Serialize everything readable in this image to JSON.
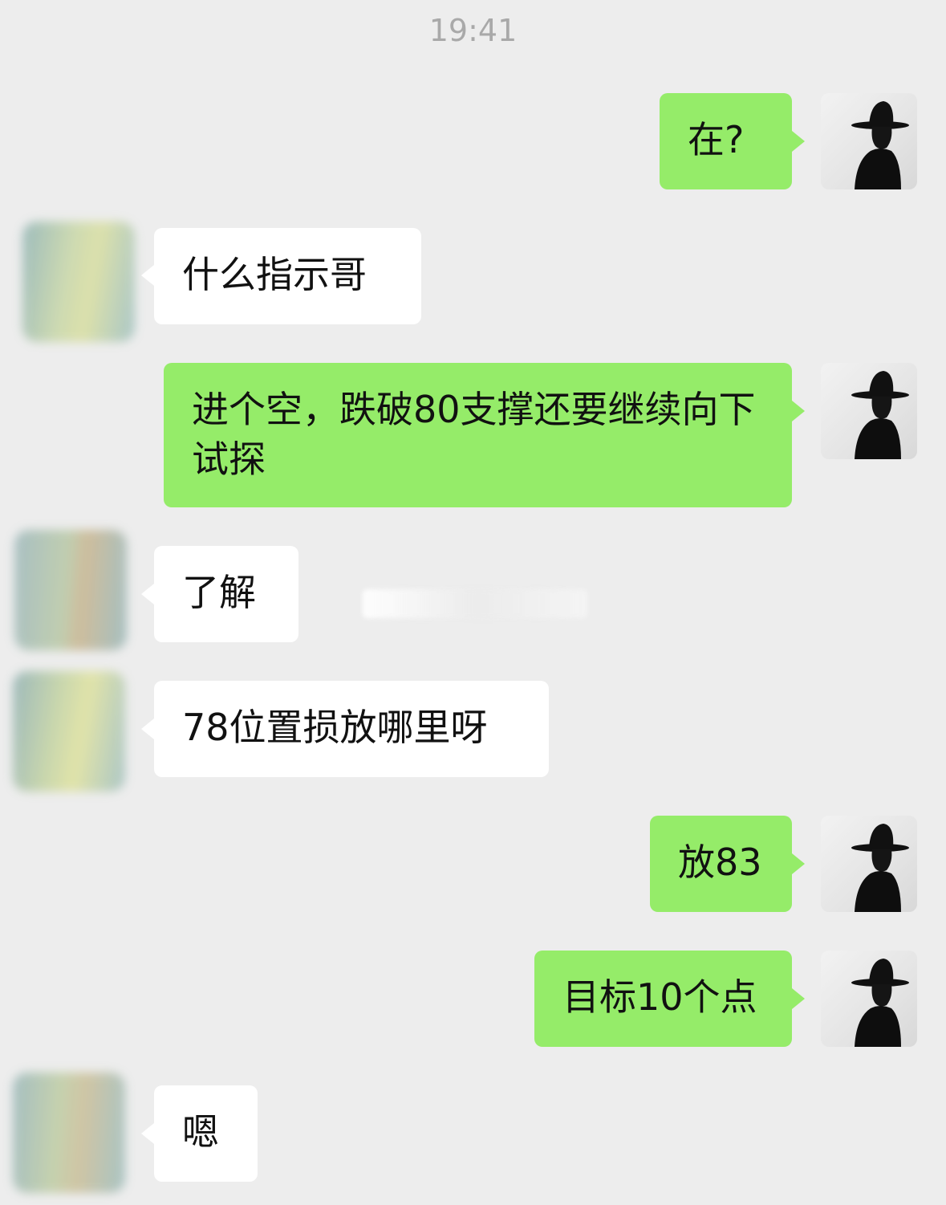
{
  "chat": {
    "timestamp": "19:41",
    "messages": [
      {
        "sender": "me",
        "text": "在?"
      },
      {
        "sender": "them",
        "text": "什么指示哥"
      },
      {
        "sender": "me",
        "text": "进个空，跌破80支撑还要继续向下试探"
      },
      {
        "sender": "them",
        "text": "了解"
      },
      {
        "sender": "them",
        "text": "78位置损放哪里呀"
      },
      {
        "sender": "me",
        "text": "放83"
      },
      {
        "sender": "me",
        "text": "目标10个点"
      },
      {
        "sender": "them",
        "text": "嗯"
      }
    ]
  },
  "colors": {
    "background": "#ededed",
    "my_bubble": "#95ec69",
    "their_bubble": "#ffffff",
    "timestamp_text": "#a9a9a9"
  },
  "icons": {
    "my_avatar": "silhouette-hat-avatar-icon",
    "their_avatar": "blurred-avatar-icon"
  }
}
